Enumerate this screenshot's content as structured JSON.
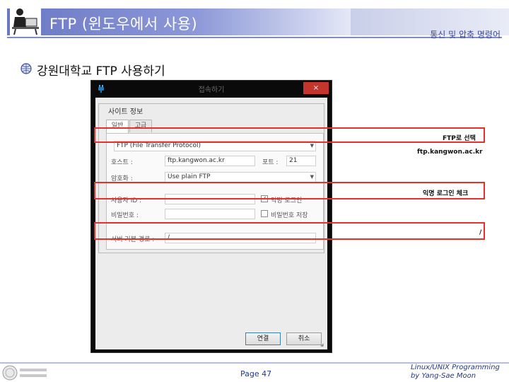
{
  "slide": {
    "title": "FTP (윈도우에서 사용)",
    "subtitle": "통신 및 압축 명령어",
    "bullet": "강원대학교 FTP 사용하기",
    "page": "Page 47",
    "credit_line1": "Linux/UNIX Programming",
    "credit_line2": "by Yang-Sae Moon"
  },
  "dialog": {
    "title": "접속하기",
    "close": "×",
    "group_title": "사이트 정보",
    "tabs": [
      {
        "label": "일반",
        "active": true
      },
      {
        "label": "고급",
        "active": false
      }
    ],
    "protocol_value": "FTP (File Transfer Protocol)",
    "host_label": "호스트 :",
    "host_value": "ftp.kangwon.ac.kr",
    "port_label": "포트 :",
    "port_value": "21",
    "encryption_label": "암호화 :",
    "encryption_value": "Use plain FTP",
    "user_label": "사용자 ID :",
    "user_value": "",
    "anonymous_label": "익명 로그인",
    "anonymous_checked": true,
    "password_label": "비밀번호 :",
    "password_value": "",
    "save_password_label": "비밀번호 저장",
    "save_password_checked": false,
    "remote_dir_label": "서버 기본 경로 :",
    "remote_dir_value": "/",
    "connect_label": "연결",
    "cancel_label": "취소"
  },
  "annotations": {
    "protocol_note": "FTP로 선택",
    "host_note": "ftp.kangwon.ac.kr",
    "anonymous_note": "익명 로그인 체크",
    "dir_note": "/"
  },
  "colors": {
    "header_band": "#6a78c4",
    "annotation_red": "#e3312d",
    "close_button": "#c4352b",
    "link_blue": "#1f3a8a"
  },
  "icons": {
    "header": "presenter-at-desk-icon",
    "bullet": "globe-bullet-icon",
    "app": "ftp-plug-icon",
    "footer": "university-logo"
  }
}
